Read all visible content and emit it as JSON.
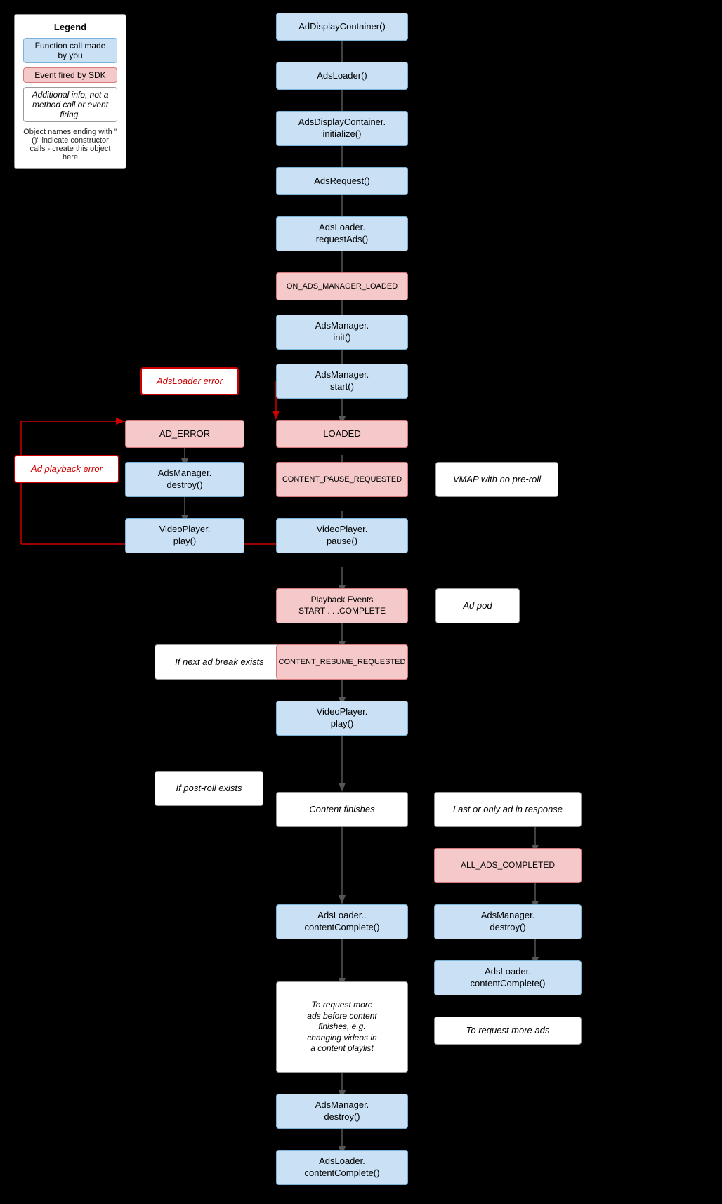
{
  "legend": {
    "title": "Legend",
    "item1": "Function call made by you",
    "item2": "Event fired by SDK",
    "item3": "Additional info, not a method call or event firing.",
    "note": "Object names ending with \"()\" indicate constructor calls - create this object here"
  },
  "nodes": {
    "adDisplayContainer": "AdDisplayContainer()",
    "adsLoader": "AdsLoader()",
    "adsDisplayContainerInit": "AdsDisplayContainer.\ninitialize()",
    "adsRequest": "AdsRequest()",
    "adsLoaderRequestAds": "AdsLoader.\nrequestAds()",
    "onAdsManagerLoaded": "ON_ADS_MANAGER_LOADED",
    "adsManagerInit": "AdsManager.\ninit()",
    "adsLoaderError": "AdsLoader error",
    "adsManagerStart": "AdsManager.\nstart()",
    "adError": "AD_ERROR",
    "loaded": "LOADED",
    "adsManagerDestroy1": "AdsManager.\ndestroy()",
    "contentPauseRequested": "CONTENT_PAUSE_REQUESTED",
    "vmapNoPreroll": "VMAP with no pre-roll",
    "videoPlayerPlay1": "VideoPlayer.\nplay()",
    "videoPlayerPause": "VideoPlayer.\npause()",
    "adPlaybackError": "Ad playback error",
    "playbackEvents": "Playback Events\nSTART . . .COMPLETE",
    "adPod": "Ad pod",
    "ifNextAdBreak": "If next ad break exists",
    "contentResumeRequested": "CONTENT_RESUME_REQUESTED",
    "videoPlayerPlay2": "VideoPlayer.\nplay()",
    "ifPostRollExists": "If post-roll exists",
    "contentFinishes": "Content finishes",
    "lastOrOnlyAd": "Last or only ad in response",
    "allAdsCompleted": "ALL_ADS_COMPLETED",
    "adsLoaderContentComplete1": "AdsLoader..\ncontentComplete()",
    "adsManagerDestroy2": "AdsManager.\ndestroy()",
    "adsLoaderContentComplete2": "AdsLoader.\ncontentComplete()",
    "toRequestMoreAds": "To request more ads",
    "toRequestMoreAdsBefore": "To request more\nads before content\nfinishes, e.g.\nchanging videos in\na content playlist",
    "adsManagerDestroy3": "AdsManager.\ndestroy()",
    "adsLoaderContentComplete3": "AdsLoader.\ncontentComplete()"
  }
}
